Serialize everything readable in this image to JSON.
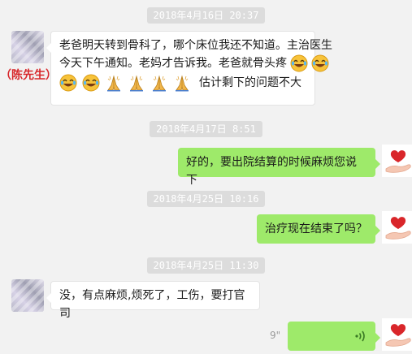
{
  "conversation": {
    "contact_name_tag": "（陈先生）",
    "timestamps": [
      "2018年4月16日 20:37",
      "2018年4月17日 8:51",
      "2018年4月25日 10:16",
      "2018年4月25日 11:30"
    ],
    "messages": [
      {
        "direction": "incoming",
        "line1": "老爸明天转到骨科了，哪个床位我还不知道。主治医生",
        "line2": "今天下午通知。老妈才告诉我。老爸就骨头疼",
        "line3_text": "估计剩下的问题不大",
        "emojis_line2": [
          "laugh-cry-emoji",
          "laugh-cry-emoji"
        ],
        "emojis_line3": [
          "laugh-cry-emoji",
          "laugh-cry-emoji",
          "pray-emoji",
          "pray-emoji",
          "pray-emoji",
          "pray-emoji"
        ]
      },
      {
        "direction": "outgoing",
        "text": "好的，要出院结算的时候麻烦您说下"
      },
      {
        "direction": "outgoing",
        "text": "治疗现在结束了吗？"
      },
      {
        "direction": "incoming",
        "text": "没，有点麻烦,烦死了，工伤，要打官司"
      },
      {
        "direction": "outgoing",
        "type": "voice",
        "duration": "9\""
      }
    ]
  },
  "colors": {
    "background": "#f2f2f2",
    "outgoing_bubble": "#9eea6a",
    "incoming_bubble": "#ffffff",
    "timestamp_bg": "#dcdcdc",
    "name_tag": "#d7262a"
  }
}
